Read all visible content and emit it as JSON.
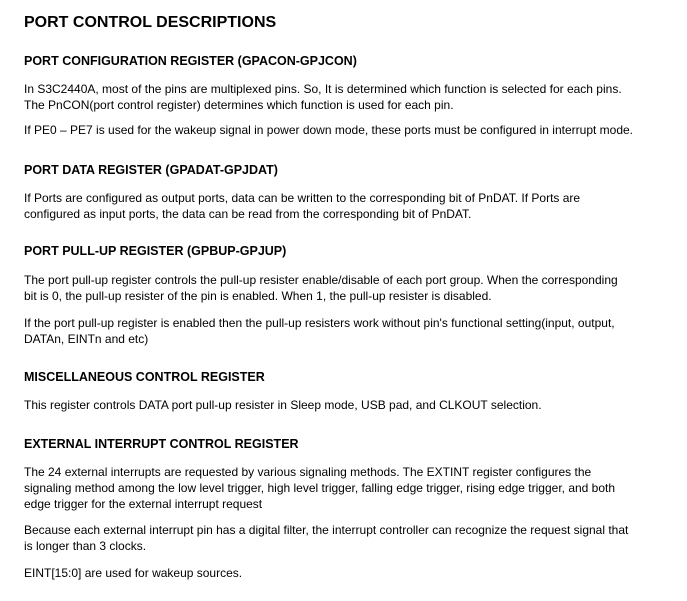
{
  "title": "PORT CONTROL DESCRIPTIONS",
  "sections": [
    {
      "heading": "PORT CONFIGURATION REGISTER (GPACON-GPJCON)",
      "paragraphs": [
        [
          "In S3C2440A, most of the pins are multiplexed pins. So, It is determined which function is selected for each pins.",
          "The PnCON(port control register) determines which function is used for each pin."
        ],
        [
          "If PE0 – PE7 is used for the wakeup signal in power down mode, these ports must be configured in interrupt mode."
        ]
      ]
    },
    {
      "heading": "PORT DATA REGISTER (GPADAT-GPJDAT)",
      "paragraphs": [
        [
          "If Ports are configured as output ports, data can be written to the corresponding bit of PnDAT. If Ports are",
          "configured as input ports, the data can be read from the corresponding bit of PnDAT."
        ]
      ]
    },
    {
      "heading": "PORT PULL-UP REGISTER (GPBUP-GPJUP)",
      "paragraphs": [
        [
          "The port pull-up register controls the pull-up resister enable/disable of each port group. When the corresponding",
          "bit is 0, the pull-up resister of the pin is enabled. When 1, the pull-up resister is disabled."
        ],
        [
          "If the port pull-up register is enabled then the pull-up resisters work without pin's functional setting(input, output,",
          "DATAn, EINTn and etc)"
        ]
      ]
    },
    {
      "heading": "MISCELLANEOUS CONTROL REGISTER",
      "paragraphs": [
        [
          "This register controls DATA port pull-up resister in Sleep mode, USB pad, and CLKOUT selection."
        ]
      ]
    },
    {
      "heading": "EXTERNAL INTERRUPT CONTROL REGISTER",
      "paragraphs": [
        [
          "The 24 external interrupts are requested by various signaling methods. The EXTINT register configures the",
          "signaling method among the low level trigger, high level trigger, falling edge trigger, rising edge trigger, and both",
          "edge trigger  for the external interrupt request"
        ],
        [
          "Because each external interrupt pin has a digital filter, the interrupt controller can recognize the request signal that",
          "is longer than 3 clocks."
        ],
        [
          "EINT[15:0] are used for wakeup sources."
        ]
      ]
    }
  ]
}
